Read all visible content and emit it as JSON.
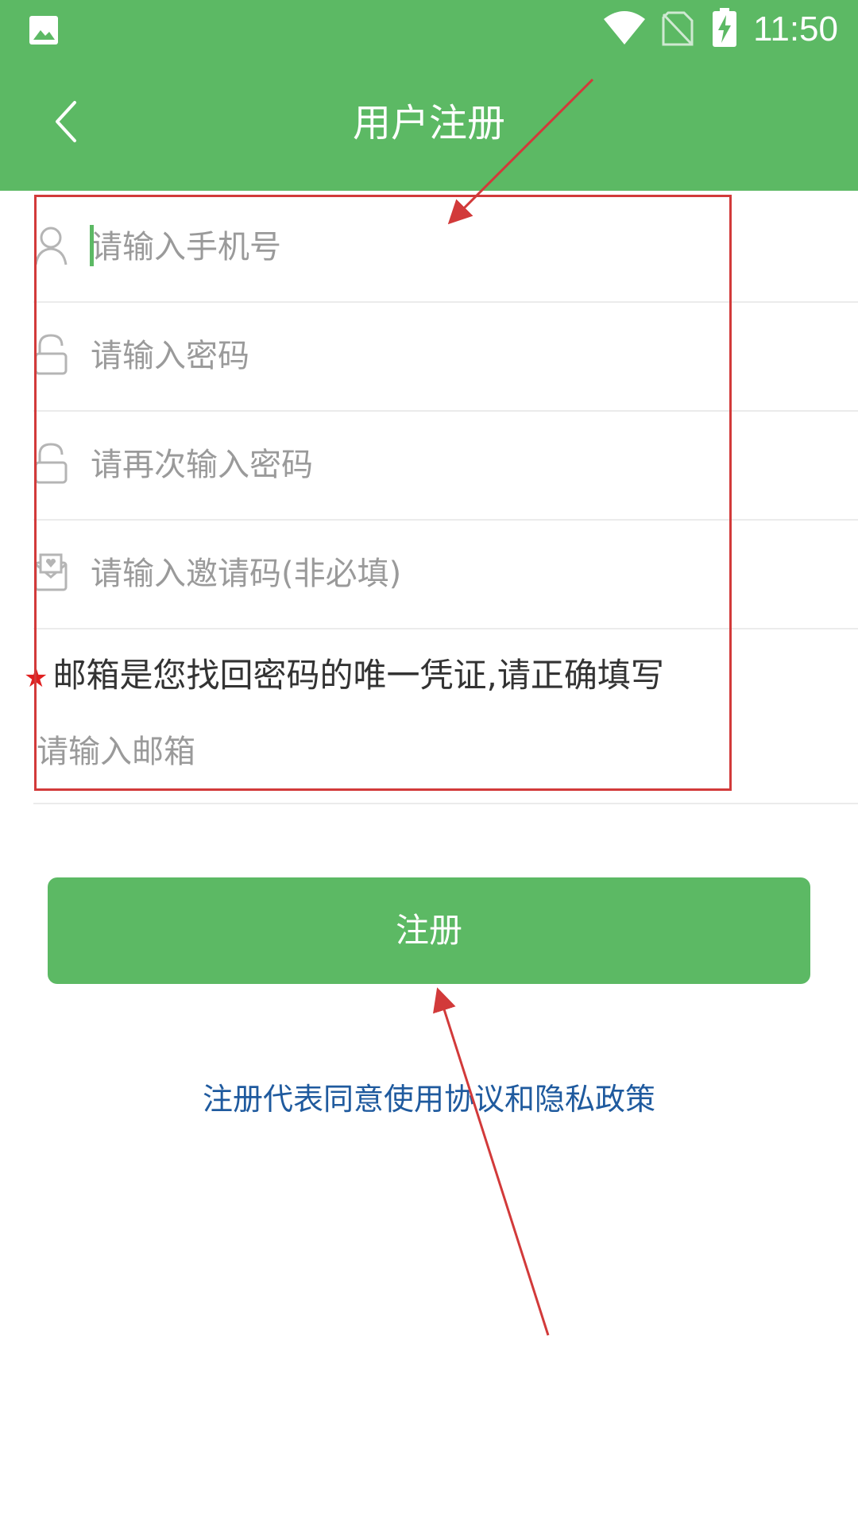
{
  "status_bar": {
    "time": "11:50",
    "icons": [
      "image-icon",
      "wifi-icon",
      "no-sim-icon",
      "battery-charging-icon"
    ]
  },
  "header": {
    "title": "用户注册",
    "back_icon": "chevron-left-icon"
  },
  "form": {
    "phone": {
      "placeholder": "请输入手机号",
      "icon": "user-icon"
    },
    "password": {
      "placeholder": "请输入密码",
      "icon": "lock-icon"
    },
    "confirm_password": {
      "placeholder": "请再次输入密码",
      "icon": "lock-icon"
    },
    "invite_code": {
      "placeholder": "请输入邀请码(非必填)",
      "icon": "invite-icon"
    },
    "email_note": {
      "star": "★",
      "text": "邮箱是您找回密码的唯一凭证,请正确填写"
    },
    "email": {
      "placeholder": "请输入邮箱"
    }
  },
  "actions": {
    "register_label": "注册",
    "agreement_text": "注册代表同意使用协议和隐私政策"
  },
  "colors": {
    "brand_green": "#5cb964",
    "link_blue": "#1f5a9e",
    "annotation_red": "#d23a3a",
    "placeholder_gray": "#9a9a9a"
  }
}
